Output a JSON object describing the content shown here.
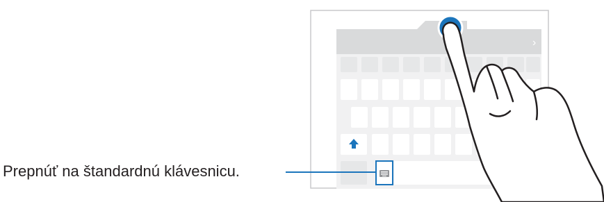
{
  "callout": {
    "text": "Prepnúť na štandardnú klávesnicu."
  },
  "keyboard": {
    "panel_arrow": "›",
    "shift_key": "shift-arrow-icon",
    "switch_key": "keyboard-switch-icon"
  },
  "colors": {
    "accent": "#1b75bc",
    "key_fill": "#ffffff",
    "toolbar": "#d9dadb",
    "panel": "#f1f1f2",
    "hand_outline": "#231f20"
  }
}
